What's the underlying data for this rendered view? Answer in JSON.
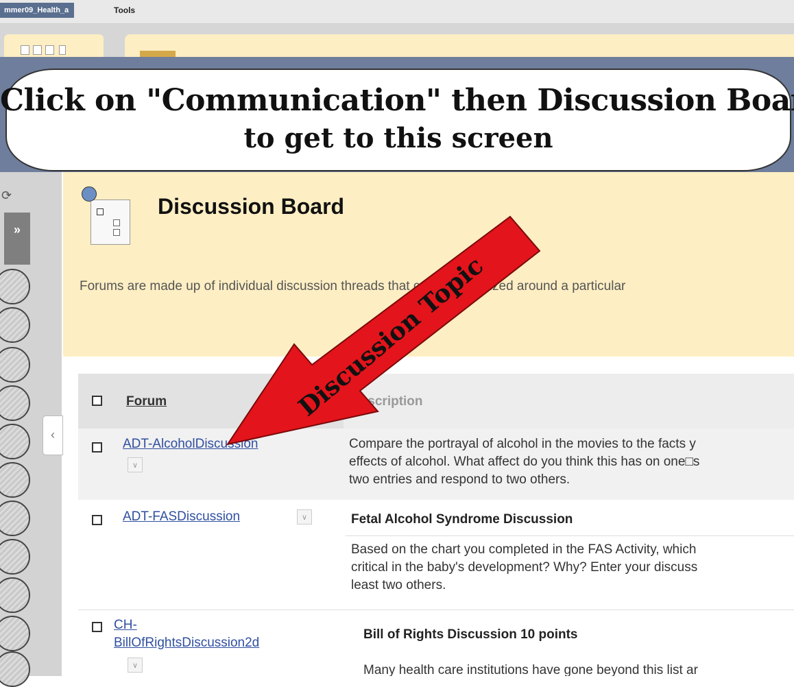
{
  "topbar": {
    "course_tab": "mmer09_Health_a",
    "tools_tab": "Tools"
  },
  "callout": {
    "line1": "Click on \"Communication\" then Discussion Board",
    "line2": "to get to this screen"
  },
  "sidebar": {
    "expand_glyph": "»",
    "collapse_glyph": "‹",
    "refresh_glyph": "⟳"
  },
  "header": {
    "title": "Discussion Board",
    "description": "Forums are made up of individual discussion threads that can be organized around a particular"
  },
  "arrow_label": "Discussion Topic",
  "table": {
    "col_forum": "Forum",
    "col_description": "Description",
    "rows": [
      {
        "forum": "ADT-AlcoholDiscussion",
        "desc_lines": [
          "Compare the portrayal of alcohol in the movies to the facts y",
          "effects of alcohol. What affect do you think this has on one□s",
          "two entries and respond to two others."
        ]
      },
      {
        "forum": "ADT-FASDiscussion",
        "desc_title": "Fetal Alcohol Syndrome Discussion",
        "desc_lines": [
          "Based on the chart you completed in the FAS Activity, which",
          "critical in the baby's development? Why? Enter your discuss",
          "least two others."
        ]
      },
      {
        "forum_line1": "CH-",
        "forum_line2": "BillOfRightsDiscussion2d",
        "desc_title": "Bill of Rights Discussion 10 points",
        "desc_lines": [
          "Many health care institutions have gone beyond this list ar"
        ]
      }
    ]
  },
  "colors": {
    "accent_arrow": "#e3141b",
    "header_bg": "#fdeec3",
    "link": "#2f4fa0"
  }
}
